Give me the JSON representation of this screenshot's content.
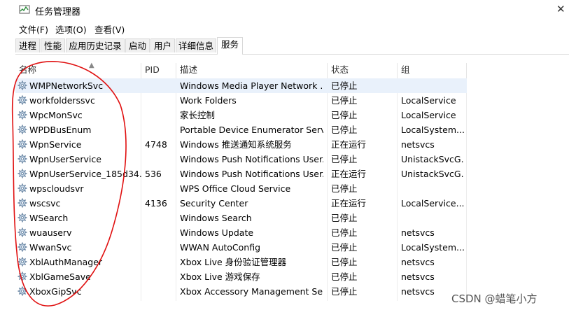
{
  "window": {
    "title": "任务管理器"
  },
  "menu": [
    "文件(F)",
    "选项(O)",
    "查看(V)"
  ],
  "tabs": [
    "进程",
    "性能",
    "应用历史记录",
    "启动",
    "用户",
    "详细信息",
    "服务"
  ],
  "active_tab": "服务",
  "table": {
    "columns": [
      "名称",
      "PID",
      "描述",
      "状态",
      "组"
    ],
    "rows": [
      {
        "name": "WMPNetworkSvc",
        "pid": "",
        "desc": "Windows Media Player Network ...",
        "status": "已停止",
        "group": ""
      },
      {
        "name": "workfolderssvc",
        "pid": "",
        "desc": "Work Folders",
        "status": "已停止",
        "group": "LocalService"
      },
      {
        "name": "WpcMonSvc",
        "pid": "",
        "desc": "家长控制",
        "status": "已停止",
        "group": "LocalService"
      },
      {
        "name": "WPDBusEnum",
        "pid": "",
        "desc": "Portable Device Enumerator Serv...",
        "status": "已停止",
        "group": "LocalSystem..."
      },
      {
        "name": "WpnService",
        "pid": "4748",
        "desc": "Windows 推送通知系统服务",
        "status": "正在运行",
        "group": "netsvcs"
      },
      {
        "name": "WpnUserService",
        "pid": "",
        "desc": "Windows Push Notifications User...",
        "status": "已停止",
        "group": "UnistackSvcG..."
      },
      {
        "name": "WpnUserService_185d34...",
        "pid": "536",
        "desc": "Windows Push Notifications User...",
        "status": "正在运行",
        "group": "UnistackSvcG..."
      },
      {
        "name": "wpscloudsvr",
        "pid": "",
        "desc": "WPS Office Cloud Service",
        "status": "已停止",
        "group": ""
      },
      {
        "name": "wscsvc",
        "pid": "4136",
        "desc": "Security Center",
        "status": "正在运行",
        "group": "LocalService..."
      },
      {
        "name": "WSearch",
        "pid": "",
        "desc": "Windows Search",
        "status": "已停止",
        "group": ""
      },
      {
        "name": "wuauserv",
        "pid": "",
        "desc": "Windows Update",
        "status": "已停止",
        "group": "netsvcs"
      },
      {
        "name": "WwanSvc",
        "pid": "",
        "desc": "WWAN AutoConfig",
        "status": "已停止",
        "group": "LocalSystem..."
      },
      {
        "name": "XblAuthManager",
        "pid": "",
        "desc": "Xbox Live 身份验证管理器",
        "status": "已停止",
        "group": "netsvcs"
      },
      {
        "name": "XblGameSave",
        "pid": "",
        "desc": "Xbox Live 游戏保存",
        "status": "已停止",
        "group": "netsvcs"
      },
      {
        "name": "XboxGipSvc",
        "pid": "",
        "desc": "Xbox Accessory Management Se...",
        "status": "已停止",
        "group": "netsvcs"
      }
    ]
  },
  "watermark": "CSDN @蜡笔小方",
  "colors": {
    "annotation": "#e01010",
    "selected_row": "#e9f1fb"
  }
}
